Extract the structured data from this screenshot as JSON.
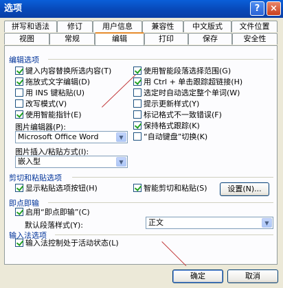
{
  "window": {
    "title": "选项",
    "help": "?",
    "close": "×"
  },
  "tabs_row1": [
    "拼写和语法",
    "修订",
    "用户信息",
    "兼容性",
    "中文版式",
    "文件位置"
  ],
  "tabs_row2": [
    "视图",
    "常规",
    "编辑",
    "打印",
    "保存",
    "安全性"
  ],
  "sections": {
    "edit": "编辑选项",
    "cutpaste": "剪切和粘贴选项",
    "clicktype": "即点即输",
    "ime": "输入法选项"
  },
  "left_options": [
    {
      "label": "键入内容替换所选内容(T)",
      "checked": true
    },
    {
      "label": "拖放式文字编辑(D)",
      "checked": true
    },
    {
      "label": "用 INS 键粘贴(U)",
      "checked": false
    },
    {
      "label": "改写模式(V)",
      "checked": false
    },
    {
      "label": "使用智能指针(E)",
      "checked": true
    }
  ],
  "right_options": [
    {
      "label": "使用智能段落选择范围(G)",
      "checked": true
    },
    {
      "label": "用 Ctrl + 单击跟踪超链接(H)",
      "checked": true
    },
    {
      "label": "选定时自动选定整个单词(W)",
      "checked": false
    },
    {
      "label": "提示更新样式(Y)",
      "checked": false
    },
    {
      "label": "标记格式不一致错误(F)",
      "checked": false
    },
    {
      "label": "保持格式跟踪(K)",
      "checked": true
    },
    {
      "label": "“自动键盘”切换(K)",
      "checked": false
    }
  ],
  "picture_editor": {
    "label": "图片编辑器(P):",
    "value": "Microsoft Office Word"
  },
  "insert_paste": {
    "label": "图片插入/粘贴方式(I):",
    "value": "嵌入型"
  },
  "cutpaste": {
    "show_buttons": {
      "label": "显示粘贴选项按钮(H)",
      "checked": true
    },
    "smart_cut": {
      "label": "智能剪切和粘贴(S)",
      "checked": true
    },
    "settings_button": "设置(N)..."
  },
  "clicktype": {
    "enable": {
      "label": "启用“即点即输”(C)",
      "checked": true
    },
    "style_label": "默认段落样式(Y):",
    "style_value": "正文"
  },
  "ime": {
    "control": {
      "label": "输入法控制处于活动状态(L)",
      "checked": true
    }
  },
  "buttons": {
    "ok": "确定",
    "cancel": "取消"
  },
  "colors": {
    "title_bar": "#0848b8",
    "tab_highlight": "#e68b2c",
    "annotation_arrow": "#c2383a",
    "section_text": "#003399"
  }
}
